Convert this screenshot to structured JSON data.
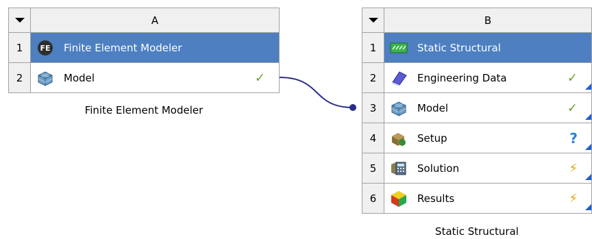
{
  "systemA": {
    "column_letter": "A",
    "caption": "Finite Element Modeler",
    "rows": [
      {
        "num": "1",
        "label": "Finite Element Modeler",
        "icon": "fe-icon",
        "status": ""
      },
      {
        "num": "2",
        "label": "Model",
        "icon": "model-mesh-icon",
        "status": "✓"
      }
    ]
  },
  "systemB": {
    "column_letter": "B",
    "caption": "Static Structural",
    "rows": [
      {
        "num": "1",
        "label": "Static Structural",
        "icon": "static-structural-icon",
        "status": ""
      },
      {
        "num": "2",
        "label": "Engineering Data",
        "icon": "engineering-data-icon",
        "status": "✓"
      },
      {
        "num": "3",
        "label": "Model",
        "icon": "model-mesh-icon",
        "status": "✓"
      },
      {
        "num": "4",
        "label": "Setup",
        "icon": "setup-icon",
        "status": "?"
      },
      {
        "num": "5",
        "label": "Solution",
        "icon": "solution-icon",
        "status": "⚡"
      },
      {
        "num": "6",
        "label": "Results",
        "icon": "results-icon",
        "status": "⚡"
      }
    ]
  },
  "colors": {
    "title_row": "#4d7fc1",
    "check": "#6aa12a",
    "question": "#2a7fd6",
    "bolt": "#e6a100",
    "link": "#2b2b8c"
  }
}
